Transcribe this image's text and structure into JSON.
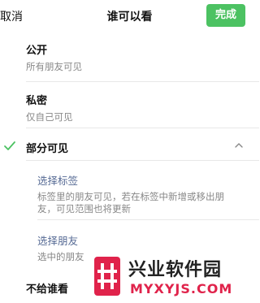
{
  "header": {
    "cancel_label": "取消",
    "title": "谁可以看",
    "done_label": "完成"
  },
  "options": {
    "public": {
      "title": "公开",
      "subtitle": "所有朋友可见"
    },
    "private": {
      "title": "私密",
      "subtitle": "仅自己可见"
    },
    "partial": {
      "title": "部分可见",
      "selected": true,
      "expanded": true,
      "sub_options": {
        "tags": {
          "title": "选择标签",
          "desc": "标签里的朋友可见，若在标签中新增或移出朋友，可见范围也将更新"
        },
        "friends": {
          "title": "选择朋友",
          "desc": "选中的朋友"
        }
      }
    },
    "exclude": {
      "title": "不给谁看"
    }
  },
  "watermark": {
    "name": "兴业软件园",
    "domain": "MYXYJS.COM"
  },
  "colors": {
    "accent_green": "#4cc262",
    "link_blue": "#576b95",
    "watermark_red": "#e0234b"
  }
}
